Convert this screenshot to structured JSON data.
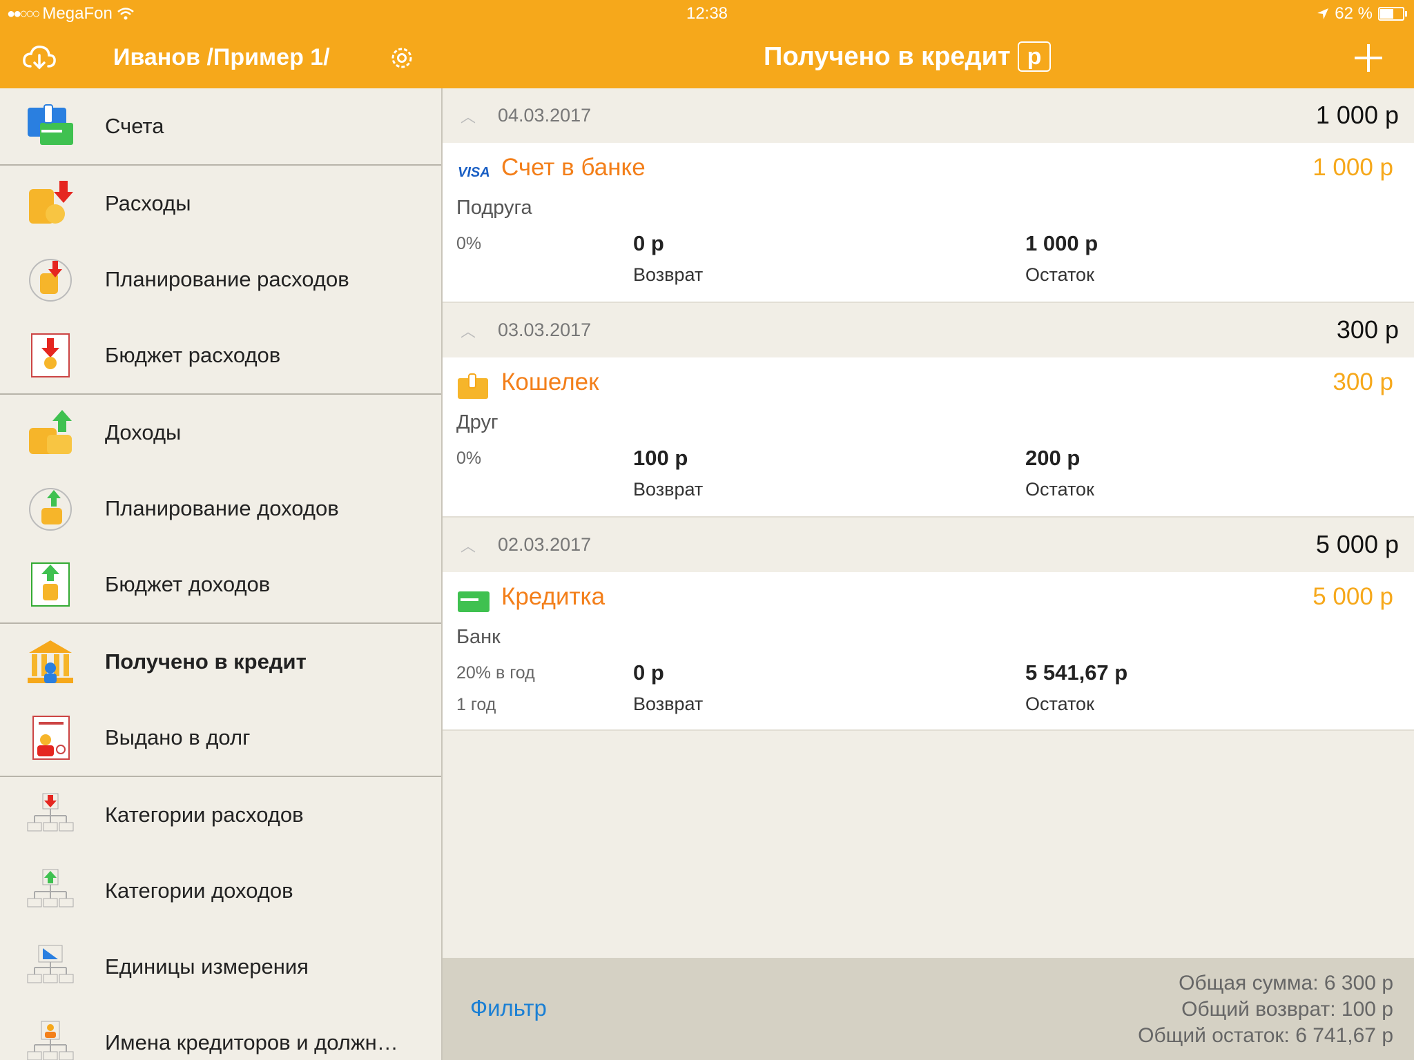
{
  "status": {
    "carrier": "MegaFon",
    "time": "12:38",
    "battery": "62 %"
  },
  "sidebar": {
    "title": "Иванов /Пример 1/",
    "items": [
      {
        "label": "Счета",
        "icon": "wallet-icon"
      },
      {
        "label": "Расходы",
        "icon": "expenses-coins-icon"
      },
      {
        "label": "Планирование расходов",
        "icon": "expense-planning-icon"
      },
      {
        "label": "Бюджет расходов",
        "icon": "expense-budget-icon"
      },
      {
        "label": "Доходы",
        "icon": "income-coins-icon"
      },
      {
        "label": "Планирование доходов",
        "icon": "income-planning-icon"
      },
      {
        "label": "Бюджет доходов",
        "icon": "income-budget-icon"
      },
      {
        "label": "Получено в кредит",
        "icon": "bank-icon"
      },
      {
        "label": "Выдано в долг",
        "icon": "debt-document-icon"
      },
      {
        "label": "Категории расходов",
        "icon": "expense-categories-icon"
      },
      {
        "label": "Категории доходов",
        "icon": "income-categories-icon"
      },
      {
        "label": "Единицы измерения",
        "icon": "units-icon"
      },
      {
        "label": "Имена кредиторов и должн…",
        "icon": "creditor-names-icon"
      }
    ]
  },
  "header": {
    "title": "Получено в кредит",
    "currency": "р"
  },
  "groups": [
    {
      "date": "04.03.2017",
      "sum": "1 000 р",
      "account": "Счет в банке",
      "account_icon": "visa-icon",
      "amount": "1 000 р",
      "person": "Подруга",
      "rate": "0%",
      "term": "",
      "returned": "0 р",
      "returned_label": "Возврат",
      "balance": "1 000 р",
      "balance_label": "Остаток"
    },
    {
      "date": "03.03.2017",
      "sum": "300 р",
      "account": "Кошелек",
      "account_icon": "wallet-icon",
      "amount": "300 р",
      "person": "Друг",
      "rate": "0%",
      "term": "",
      "returned": "100 р",
      "returned_label": "Возврат",
      "balance": "200 р",
      "balance_label": "Остаток"
    },
    {
      "date": "02.03.2017",
      "sum": "5 000 р",
      "account": "Кредитка",
      "account_icon": "credit-card-icon",
      "amount": "5 000 р",
      "person": "Банк",
      "rate": "20% в год",
      "term": "1 год",
      "returned": "0 р",
      "returned_label": "Возврат",
      "balance": "5 541,67 р",
      "balance_label": "Остаток"
    }
  ],
  "footer": {
    "filter": "Фильтр",
    "total_sum": "Общая сумма: 6 300 р",
    "total_returned": "Общий возврат: 100 р",
    "total_balance": "Общий остаток: 6 741,67 р"
  },
  "colors": {
    "accent": "#f6a81b",
    "account_name": "#f37f1a",
    "link": "#1a7fd4"
  }
}
